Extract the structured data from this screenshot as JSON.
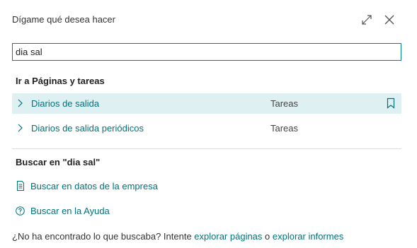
{
  "dialog": {
    "title": "Dígame qué desea hacer",
    "icons": {
      "expand": "expand-arrows-icon",
      "close": "close-icon"
    }
  },
  "search": {
    "value": "dia sal",
    "placeholder": ""
  },
  "pages_section": {
    "heading": "Ir a Páginas y tareas",
    "results": [
      {
        "name": "Diarios de salida",
        "category": "Tareas",
        "selected": true
      },
      {
        "name": "Diarios de salida periódicos",
        "category": "Tareas",
        "selected": false
      }
    ]
  },
  "search_section": {
    "heading": "Buscar en \"dia sal\"",
    "actions": [
      {
        "label": "Buscar en datos de la empresa",
        "icon": "company-data-icon"
      },
      {
        "label": "Buscar en la Ayuda",
        "icon": "help-icon"
      }
    ]
  },
  "footer": {
    "prefix": "¿No ha encontrado lo que buscaba? Intente ",
    "link1": "explorar páginas",
    "middle": " o ",
    "link2": "explorar informes"
  },
  "colors": {
    "accent": "#00727a",
    "border": "#00838f",
    "selected_bg": "#dff0f2"
  }
}
